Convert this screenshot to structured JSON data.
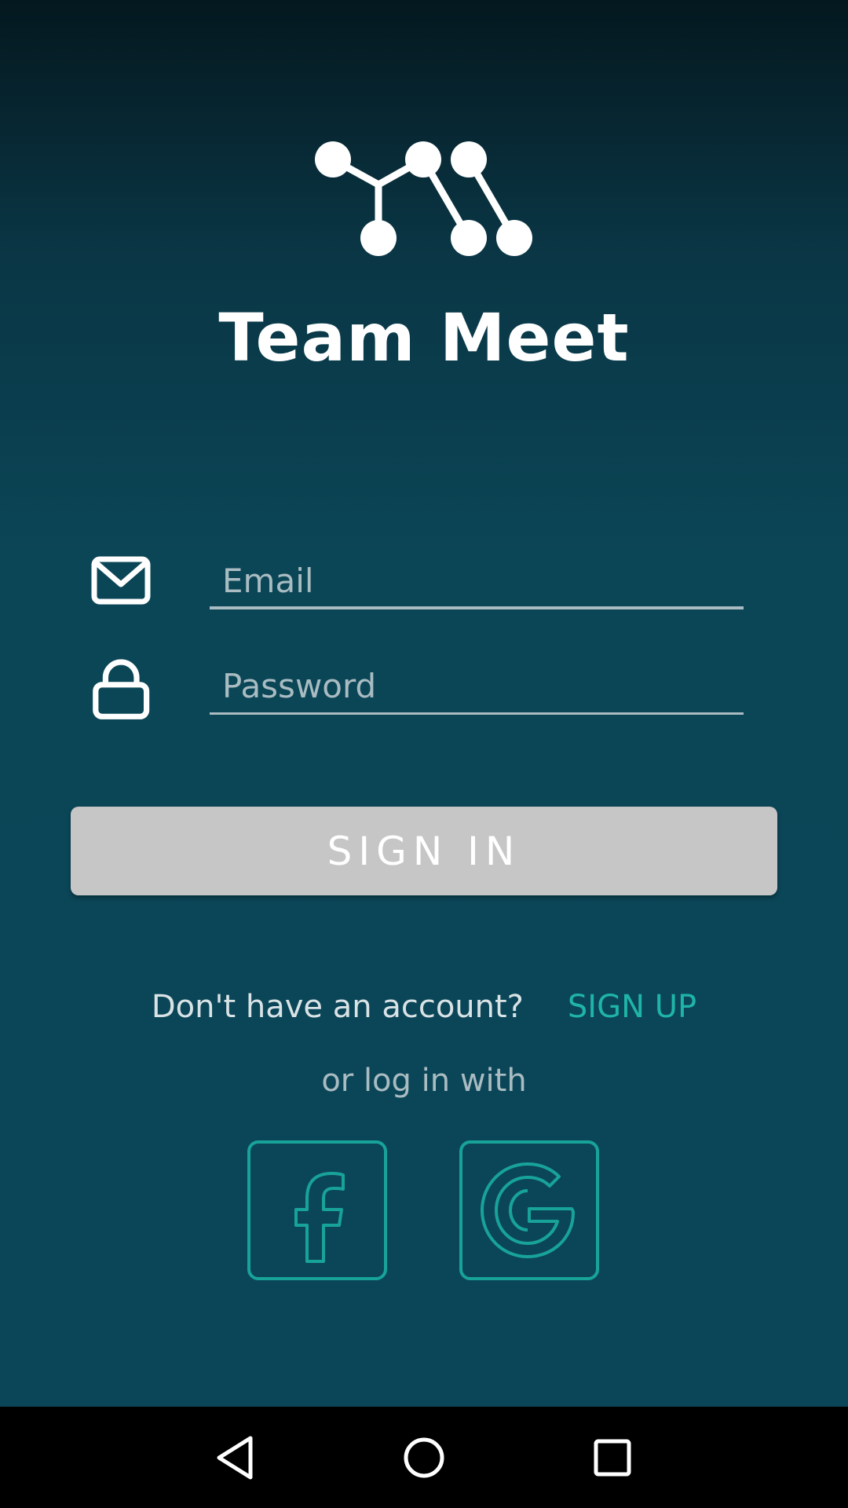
{
  "app": {
    "title": "Team Meet",
    "logo_icon": "network-nodes-logo"
  },
  "form": {
    "email": {
      "icon": "envelope-icon",
      "placeholder": "Email",
      "value": ""
    },
    "password": {
      "icon": "lock-icon",
      "placeholder": "Password",
      "value": ""
    },
    "signin_label": "SIGN IN"
  },
  "signup": {
    "prompt": "Don't have an account?",
    "link_label": "SIGN UP"
  },
  "social": {
    "prompt": "or log in with",
    "providers": [
      {
        "name": "facebook",
        "icon": "facebook-icon"
      },
      {
        "name": "google",
        "icon": "google-icon"
      }
    ]
  },
  "navigation": {
    "buttons": [
      "back-icon",
      "home-icon",
      "recents-icon"
    ]
  },
  "colors": {
    "background_top": "#04181f",
    "background": "#0b4658",
    "accent": "#1fb5a6",
    "button_bg": "#c6c6c6",
    "placeholder": "#a9bcc2"
  }
}
